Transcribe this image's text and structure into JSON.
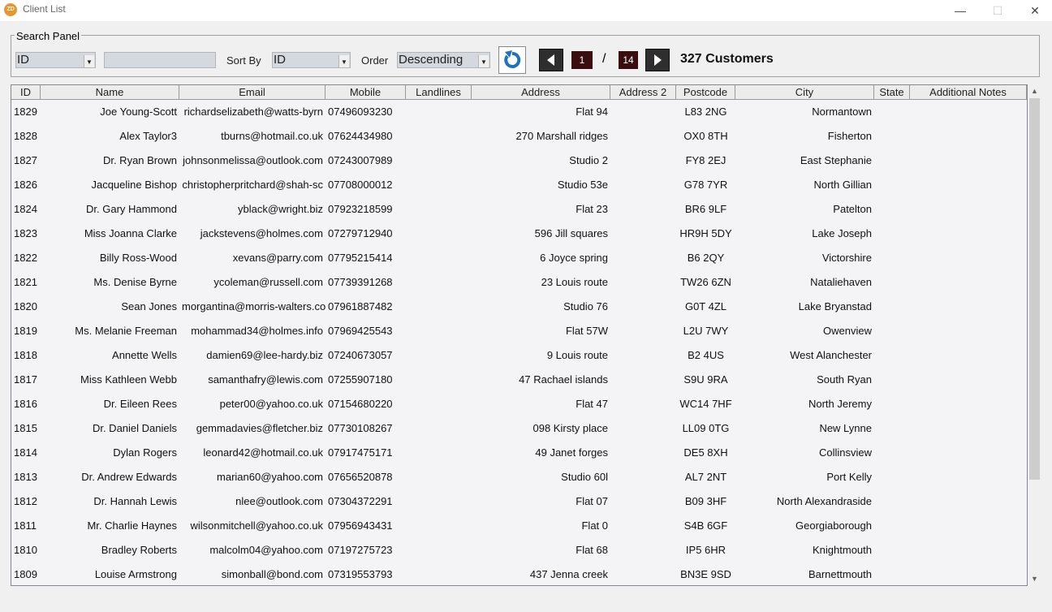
{
  "window": {
    "title": "Client List",
    "icon_label": "ZD",
    "minimize": "—",
    "maximize": "☐",
    "close": "✕"
  },
  "search": {
    "panel_label": "Search Panel",
    "field_value": "ID",
    "query_value": "",
    "sort_by_label": "Sort By",
    "sort_by_value": "ID",
    "order_label": "Order",
    "order_value": "Descending",
    "dropdown_arrow": "▼"
  },
  "pagination": {
    "current_page": "1",
    "separator": "/",
    "total_pages": "14",
    "count_label": "327 Customers"
  },
  "table": {
    "columns": [
      "ID",
      "Name",
      "Email",
      "Mobile",
      "Landlines",
      "Address",
      "Address 2",
      "Postcode",
      "City",
      "State",
      "Additional Notes"
    ],
    "rows": [
      [
        "1829",
        "Joe Young-Scott",
        "richardselizabeth@watts-byrn",
        "07496093230",
        "",
        "Flat 94",
        "",
        "L83 2NG",
        "Normantown",
        "",
        ""
      ],
      [
        "1828",
        "Alex Taylor3",
        "tburns@hotmail.co.uk",
        "07624434980",
        "",
        "270 Marshall ridges",
        "",
        "OX0 8TH",
        "Fisherton",
        "",
        ""
      ],
      [
        "1827",
        "Dr. Ryan Brown",
        "johnsonmelissa@outlook.com",
        "07243007989",
        "",
        "Studio 2",
        "",
        "FY8 2EJ",
        "East Stephanie",
        "",
        ""
      ],
      [
        "1826",
        "Jacqueline Bishop",
        "christopherpritchard@shah-sc",
        "07708000012",
        "",
        "Studio 53e",
        "",
        "G78 7YR",
        "North Gillian",
        "",
        ""
      ],
      [
        "1824",
        "Dr. Gary Hammond",
        "yblack@wright.biz",
        "07923218599",
        "",
        "Flat 23",
        "",
        "BR6 9LF",
        "Patelton",
        "",
        ""
      ],
      [
        "1823",
        "Miss Joanna Clarke",
        "jackstevens@holmes.com",
        "07279712940",
        "",
        "596 Jill squares",
        "",
        "HR9H 5DY",
        "Lake Joseph",
        "",
        ""
      ],
      [
        "1822",
        "Billy Ross-Wood",
        "xevans@parry.com",
        "07795215414",
        "",
        "6 Joyce spring",
        "",
        "B6 2QY",
        "Victorshire",
        "",
        ""
      ],
      [
        "1821",
        "Ms. Denise Byrne",
        "ycoleman@russell.com",
        "07739391268",
        "",
        "23 Louis route",
        "",
        "TW26 6ZN",
        "Nataliehaven",
        "",
        ""
      ],
      [
        "1820",
        "Sean Jones",
        "morgantina@morris-walters.co",
        "07961887482",
        "",
        "Studio 76",
        "",
        "G0T 4ZL",
        "Lake Bryanstad",
        "",
        ""
      ],
      [
        "1819",
        "Ms. Melanie Freeman",
        "mohammad34@holmes.info",
        "07969425543",
        "",
        "Flat 57W",
        "",
        "L2U 7WY",
        "Owenview",
        "",
        ""
      ],
      [
        "1818",
        "Annette Wells",
        "damien69@lee-hardy.biz",
        "07240673057",
        "",
        "9 Louis route",
        "",
        "B2 4US",
        "West Alanchester",
        "",
        ""
      ],
      [
        "1817",
        "Miss Kathleen Webb",
        "samanthafry@lewis.com",
        "07255907180",
        "",
        "47 Rachael islands",
        "",
        "S9U 9RA",
        "South Ryan",
        "",
        ""
      ],
      [
        "1816",
        "Dr. Eileen Rees",
        "peter00@yahoo.co.uk",
        "07154680220",
        "",
        "Flat 47",
        "",
        "WC14 7HF",
        "North Jeremy",
        "",
        ""
      ],
      [
        "1815",
        "Dr. Daniel Daniels",
        "gemmadavies@fletcher.biz",
        "07730108267",
        "",
        "098 Kirsty place",
        "",
        "LL09 0TG",
        "New Lynne",
        "",
        ""
      ],
      [
        "1814",
        "Dylan Rogers",
        "leonard42@hotmail.co.uk",
        "07917475171",
        "",
        "49 Janet forges",
        "",
        "DE5 8XH",
        "Collinsview",
        "",
        ""
      ],
      [
        "1813",
        "Dr. Andrew Edwards",
        "marian60@yahoo.com",
        "07656520878",
        "",
        "Studio 60l",
        "",
        "AL7 2NT",
        "Port Kelly",
        "",
        ""
      ],
      [
        "1812",
        "Dr. Hannah Lewis",
        "nlee@outlook.com",
        "07304372291",
        "",
        "Flat 07",
        "",
        "B09 3HF",
        "North Alexandraside",
        "",
        ""
      ],
      [
        "1811",
        "Mr. Charlie Haynes",
        "wilsonmitchell@yahoo.co.uk",
        "07956943431",
        "",
        "Flat 0",
        "",
        "S4B 6GF",
        "Georgiaborough",
        "",
        ""
      ],
      [
        "1810",
        "Bradley Roberts",
        "malcolm04@yahoo.com",
        "07197275723",
        "",
        "Flat 68",
        "",
        "IP5 6HR",
        "Knightmouth",
        "",
        ""
      ],
      [
        "1809",
        "Louise Armstrong",
        "simonball@bond.com",
        "07319553793",
        "",
        "437 Jenna creek",
        "",
        "BN3E 9SD",
        "Barnettmouth",
        "",
        ""
      ]
    ]
  },
  "colors": {
    "accent_refresh": "#1e73be",
    "page_box": "#3a0e0e",
    "nav_button": "#2e2e2e"
  },
  "icons": {
    "refresh": "refresh-icon",
    "prev": "prev-page-icon",
    "next": "next-page-icon"
  }
}
